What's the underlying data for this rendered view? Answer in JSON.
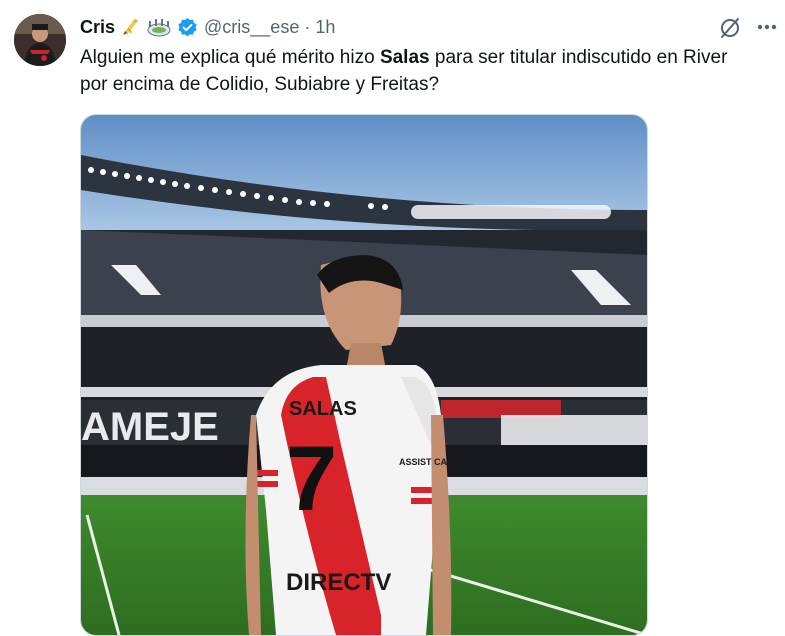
{
  "tweet": {
    "author_name": "Cris",
    "handle": "@cris__ese",
    "separator": "·",
    "time": "1h",
    "text_before": "Alguien me explica qué mérito hizo ",
    "text_bold": "Salas",
    "text_after": " para ser titular indiscutido en River por encima de Colidio, Subiabre y Freitas?"
  },
  "media": {
    "jersey_name": "SALAS",
    "jersey_number": "7",
    "sponsor": "DIRECTV",
    "brand": "ASSIST CARD",
    "stand_lettering": "AMEJE"
  },
  "colors": {
    "accent_verified": "#1d9bf0",
    "secondary_text": "#536471",
    "river_red": "#d8232a"
  }
}
